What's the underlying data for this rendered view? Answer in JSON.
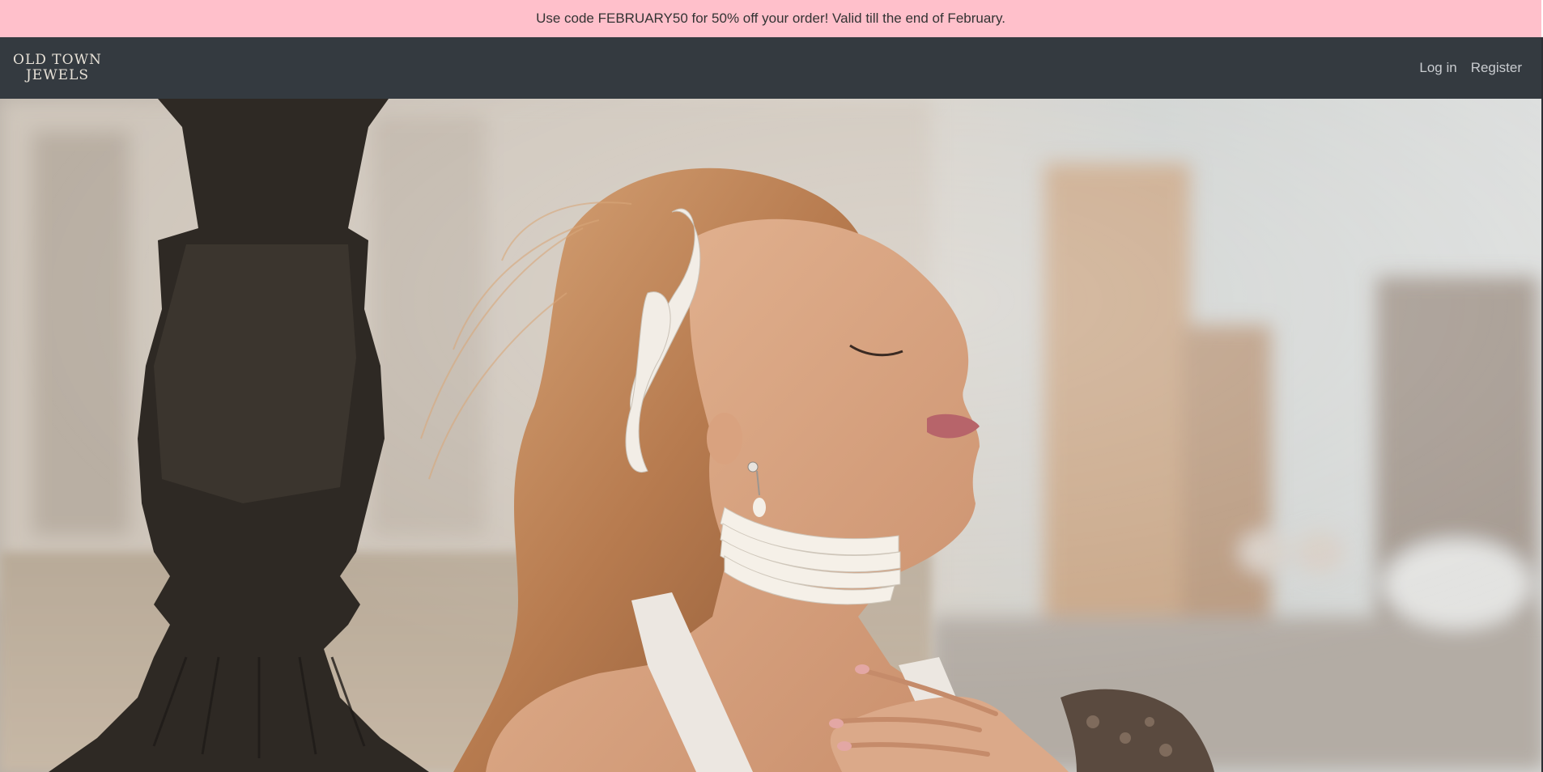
{
  "promo": {
    "text": "Use code FEBRUARY50 for 50% off your order! Valid till the end of February."
  },
  "navbar": {
    "logo_line1": "OLD TOWN",
    "logo_line2": "JEWELS",
    "login_label": "Log in",
    "register_label": "Register"
  },
  "hero": {
    "image_subject": "woman-with-pearl-choker-and-hair-clip",
    "icon": "hero-photo"
  },
  "colors": {
    "promo_bg": "#ffc0cb",
    "navbar_bg": "#343a40",
    "nav_link": "#c9ccd0"
  }
}
